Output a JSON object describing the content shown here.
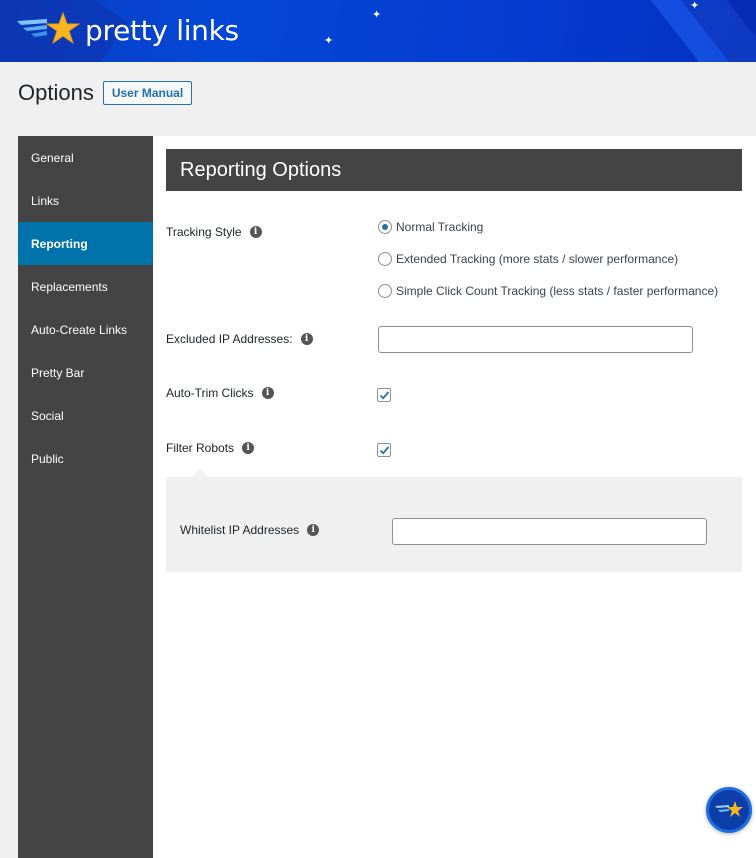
{
  "brand": {
    "name": "pretty links",
    "logo_icon": "shooting-star-icon",
    "banner_color": "#0447d6"
  },
  "page": {
    "title": "Options",
    "user_manual_label": "User Manual"
  },
  "sidebar": {
    "items": [
      {
        "label": "General",
        "active": false
      },
      {
        "label": "Links",
        "active": false
      },
      {
        "label": "Reporting",
        "active": true
      },
      {
        "label": "Replacements",
        "active": false
      },
      {
        "label": "Auto-Create Links",
        "active": false
      },
      {
        "label": "Pretty Bar",
        "active": false
      },
      {
        "label": "Social",
        "active": false
      },
      {
        "label": "Public",
        "active": false
      }
    ],
    "active_color": "#0073aa"
  },
  "section": {
    "title": "Reporting Options"
  },
  "fields": {
    "tracking_style": {
      "label": "Tracking Style",
      "options": [
        {
          "label": "Normal Tracking",
          "checked": true
        },
        {
          "label": "Extended Tracking (more stats / slower performance)",
          "checked": false
        },
        {
          "label": "Simple Click Count Tracking (less stats / faster performance)",
          "checked": false
        }
      ]
    },
    "excluded_ips": {
      "label": "Excluded IP Addresses:",
      "value": "",
      "placeholder": ""
    },
    "auto_trim_clicks": {
      "label": "Auto-Trim Clicks",
      "checked": true
    },
    "filter_robots": {
      "label": "Filter Robots",
      "checked": true
    },
    "whitelist_ips": {
      "label": "Whitelist IP Addresses",
      "value": "",
      "placeholder": ""
    }
  },
  "icons": {
    "info": "i"
  },
  "fab": {
    "icon": "pretty-links-help-icon"
  }
}
